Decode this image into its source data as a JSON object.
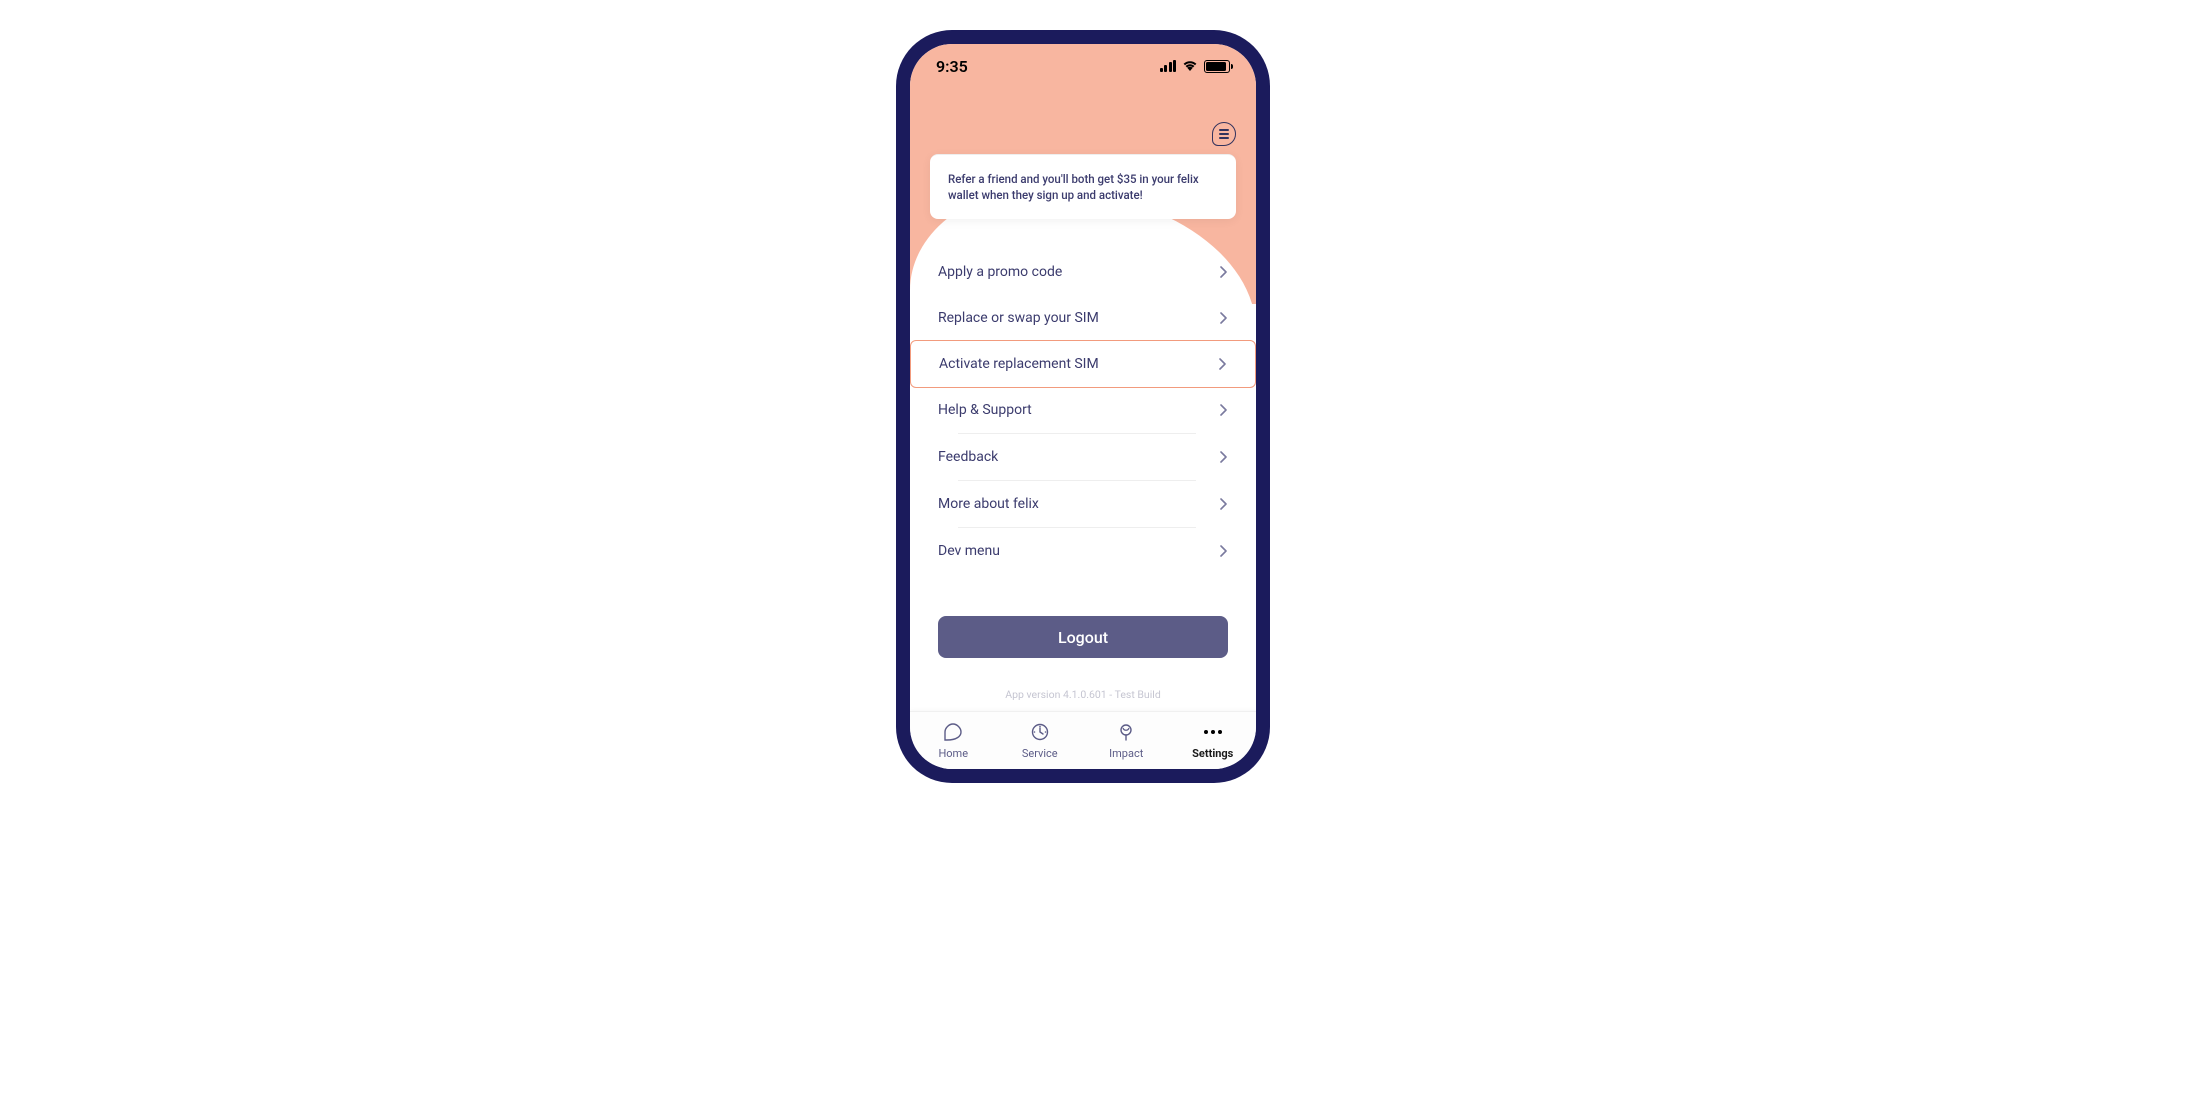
{
  "status": {
    "time": "9:35"
  },
  "referral": {
    "text": "Refer a friend and you'll both get $35 in your felix wallet when they sign up and activate!"
  },
  "menu": {
    "promo": "Apply a promo code",
    "replace_sim": "Replace or swap your SIM",
    "activate_sim": "Activate replacement SIM",
    "help": "Help & Support",
    "feedback": "Feedback",
    "more_about": "More about felix",
    "dev_menu": "Dev menu"
  },
  "logout_label": "Logout",
  "version_text": "App version 4.1.0.601 - Test Build",
  "tabs": {
    "home": "Home",
    "service": "Service",
    "impact": "Impact",
    "settings": "Settings"
  }
}
